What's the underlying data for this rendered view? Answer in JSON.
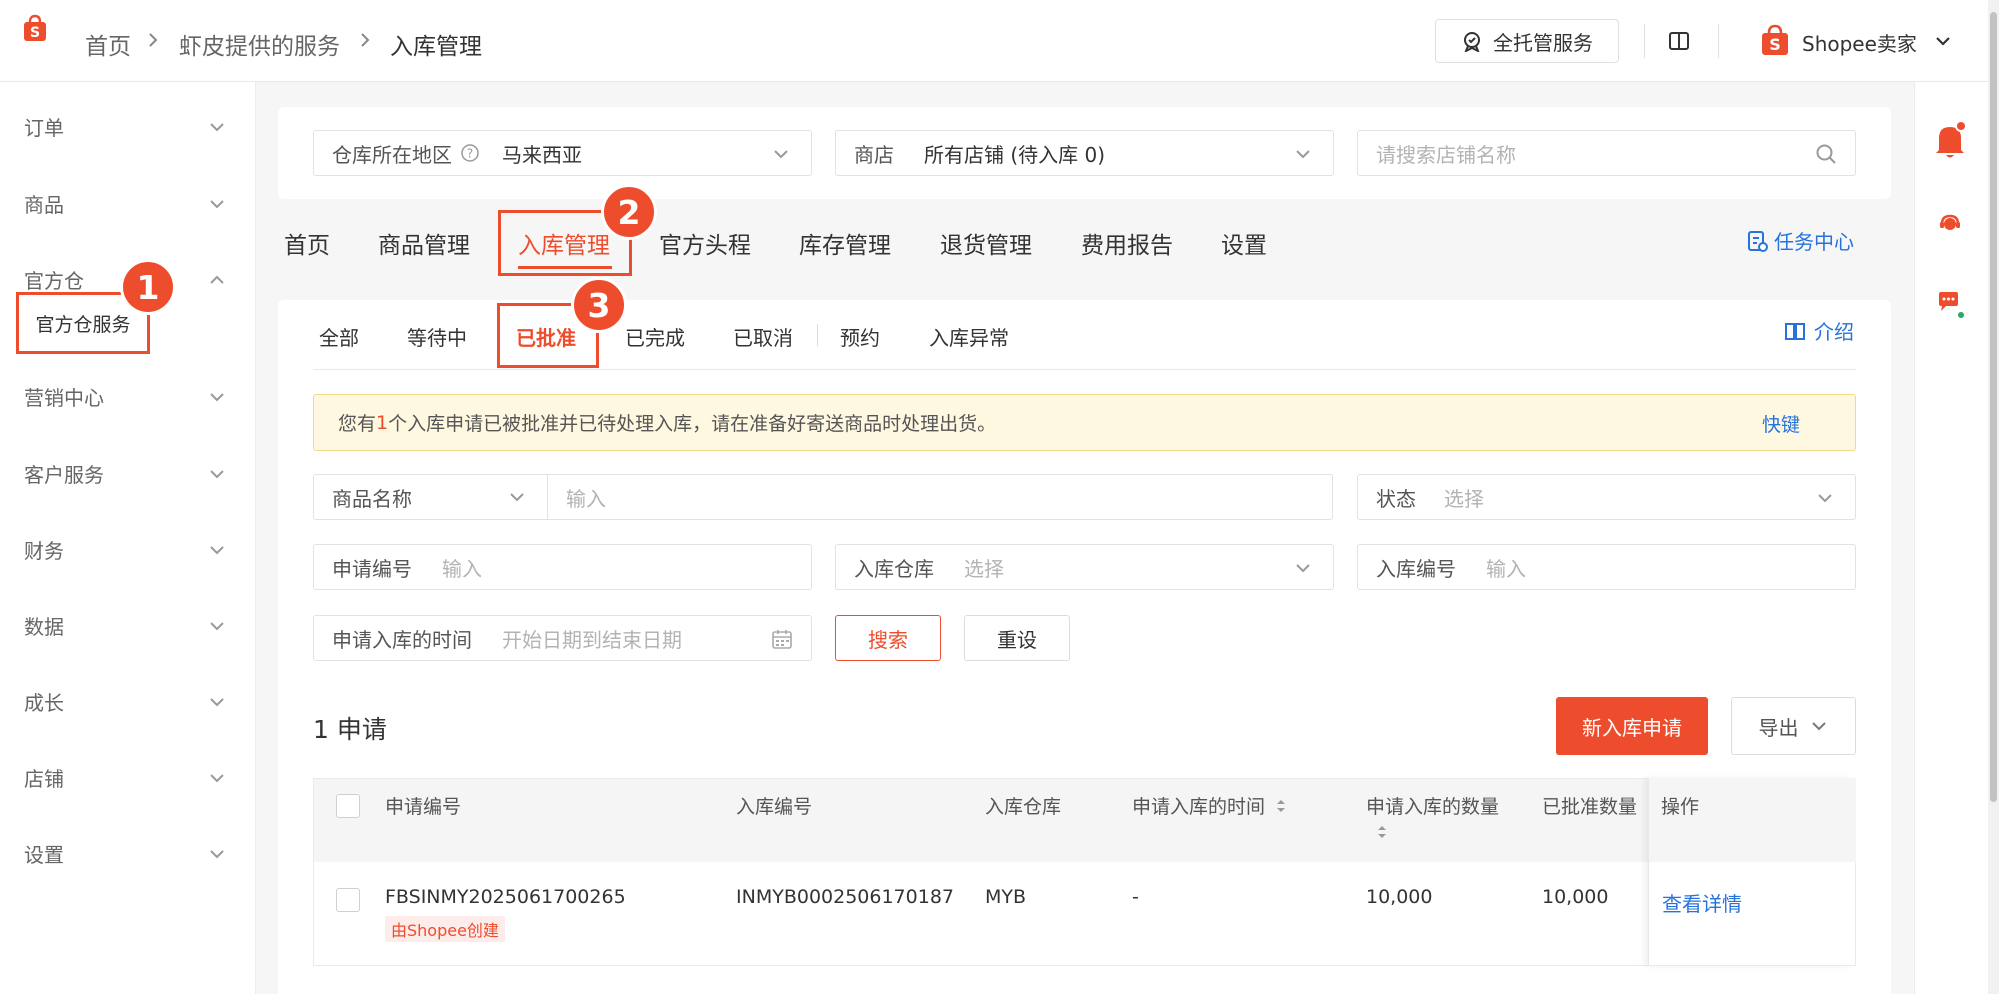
{
  "breadcrumb": [
    "首页",
    "虾皮提供的服务",
    "入库管理"
  ],
  "header": {
    "full_service_label": "全托管服务",
    "account_label": "Shopee卖家"
  },
  "sidebar": {
    "items": [
      {
        "label": "订单"
      },
      {
        "label": "商品"
      },
      {
        "label": "官方仓"
      },
      {
        "label": "营销中心"
      },
      {
        "label": "客户服务"
      },
      {
        "label": "财务"
      },
      {
        "label": "数据"
      },
      {
        "label": "成长"
      },
      {
        "label": "店铺"
      },
      {
        "label": "设置"
      }
    ],
    "sub_item_label": "官方仓服务"
  },
  "annotations": [
    "1",
    "2",
    "3"
  ],
  "filters_top": {
    "region_label": "仓库所在地区",
    "region_value": "马来西亚",
    "shop_label": "商店",
    "shop_value": "所有店铺 (待入库 0)",
    "shop_search_placeholder": "请搜索店铺名称"
  },
  "main_tabs": [
    {
      "label": "首页"
    },
    {
      "label": "商品管理"
    },
    {
      "label": "入库管理",
      "active": true
    },
    {
      "label": "官方头程"
    },
    {
      "label": "库存管理"
    },
    {
      "label": "退货管理"
    },
    {
      "label": "费用报告"
    },
    {
      "label": "设置"
    }
  ],
  "task_center_label": "任务中心",
  "sub_tabs": [
    {
      "label": "全部"
    },
    {
      "label": "等待中"
    },
    {
      "label": "已批准",
      "active": true
    },
    {
      "label": "已完成"
    },
    {
      "label": "已取消"
    },
    {
      "label": "预约"
    },
    {
      "label": "入库异常"
    }
  ],
  "intro_label": "介绍",
  "notice": {
    "prefix": "您有",
    "count": "1",
    "suffix": "个入库申请已被批准并已待处理入库，请在准备好寄送商品时处理出货。",
    "shortcut": "快键"
  },
  "search_form": {
    "product_name_label": "商品名称",
    "product_name_placeholder": "输入",
    "status_label": "状态",
    "status_placeholder": "选择",
    "request_no_label": "申请编号",
    "request_no_placeholder": "输入",
    "warehouse_label": "入库仓库",
    "warehouse_placeholder": "选择",
    "inbound_no_label": "入库编号",
    "inbound_no_placeholder": "输入",
    "date_label": "申请入库的时间",
    "date_placeholder": "开始日期到结束日期",
    "search_button": "搜索",
    "reset_button": "重设"
  },
  "results": {
    "count_label": "1 申请",
    "new_button": "新入库申请",
    "export_button": "导出"
  },
  "table": {
    "headers": [
      "申请编号",
      "入库编号",
      "入库仓库",
      "申请入库的时间",
      "申请入库的数量",
      "已批准数量",
      "操作"
    ],
    "rows": [
      {
        "request_no": "FBSINMY2025061700265",
        "tag": "由Shopee创建",
        "inbound_no": "INMYB0002506170187",
        "warehouse": "MYB",
        "time": "-",
        "requested_qty": "10,000",
        "approved_qty": "10,000",
        "action": "查看详情"
      }
    ]
  },
  "colors": {
    "brand": "#ee4d2d",
    "link": "#2673dd",
    "notice_bg": "#fff8e1"
  }
}
